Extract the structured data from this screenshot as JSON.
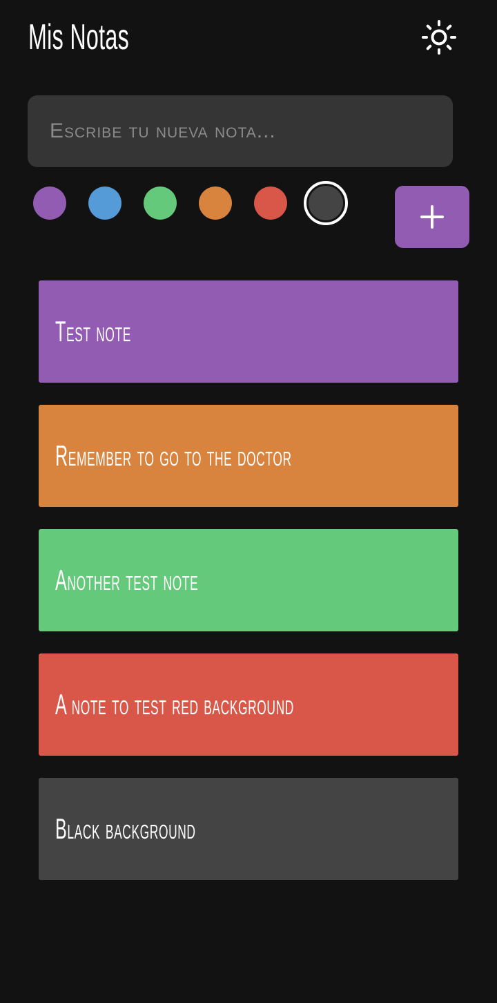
{
  "header": {
    "title": "Mis Notas",
    "theme_icon": "sun-icon"
  },
  "composer": {
    "placeholder": "Escribe tu nueva nota...",
    "value": "",
    "add_icon": "plus-icon",
    "add_button_color": "#935cb3"
  },
  "palette": {
    "selected": "dark",
    "swatches": [
      {
        "name": "purple",
        "color": "#935cb3"
      },
      {
        "name": "blue",
        "color": "#559bd8"
      },
      {
        "name": "green",
        "color": "#64c97b"
      },
      {
        "name": "orange",
        "color": "#d9843e"
      },
      {
        "name": "red",
        "color": "#d95748"
      },
      {
        "name": "dark",
        "color": "#444444"
      }
    ]
  },
  "notes": [
    {
      "text": "Test note",
      "color": "#935cb3"
    },
    {
      "text": "Remember to go to the doctor",
      "color": "#d9843e"
    },
    {
      "text": "Another test note",
      "color": "#64c97b"
    },
    {
      "text": "A note to test red background",
      "color": "#d95748"
    },
    {
      "text": "Black background",
      "color": "#444444"
    }
  ],
  "theme": {
    "background": "#121212",
    "input_background": "#353535",
    "text_color": "#ffffff"
  }
}
